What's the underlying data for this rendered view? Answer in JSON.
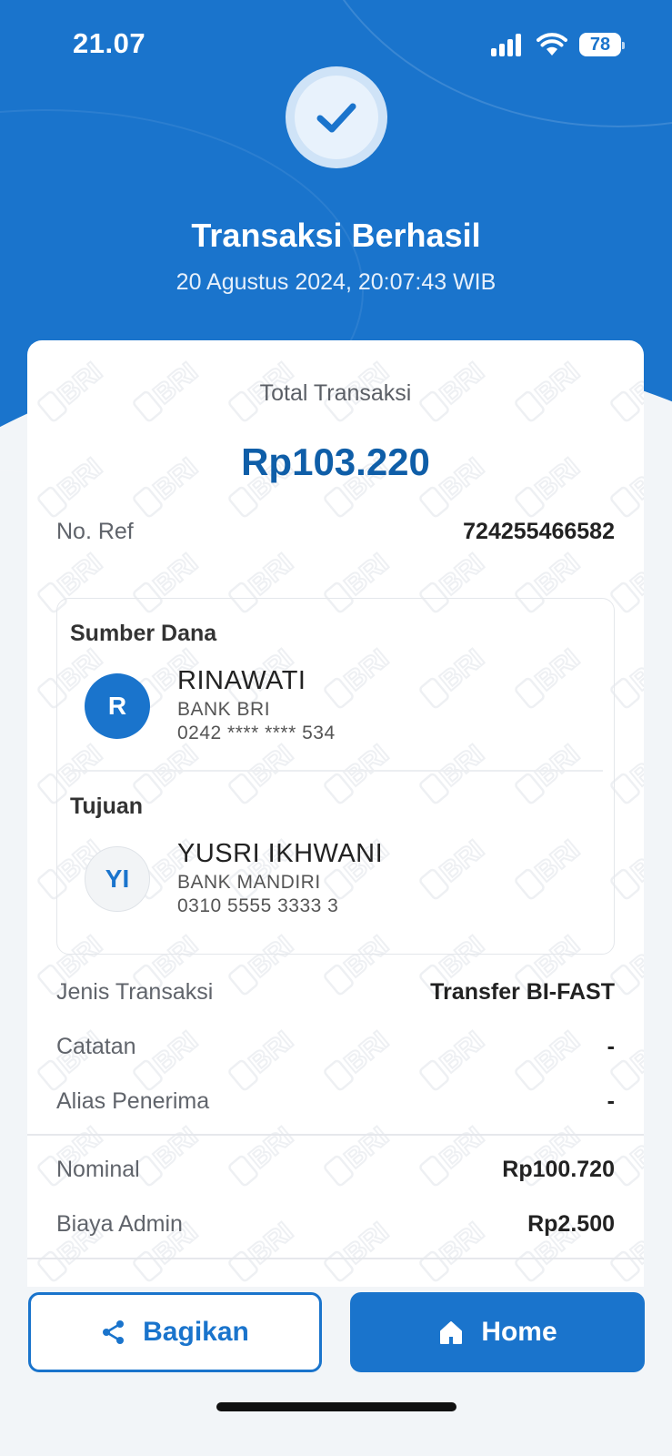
{
  "status_bar": {
    "time": "21.07",
    "battery": "78"
  },
  "header": {
    "title": "Transaksi Berhasil",
    "datetime": "20 Agustus 2024, 20:07:43 WIB"
  },
  "summary": {
    "total_label": "Total Transaksi",
    "total_amount": "Rp103.220",
    "ref_label": "No. Ref",
    "ref_value": "724255466582"
  },
  "source": {
    "heading": "Sumber Dana",
    "initials": "R",
    "name": "RINAWATI",
    "bank": "BANK BRI",
    "account": "0242 **** **** 534"
  },
  "destination": {
    "heading": "Tujuan",
    "initials": "YI",
    "name": "YUSRI IKHWANI",
    "bank": "BANK MANDIRI",
    "account": "0310 5555 3333 3"
  },
  "details": [
    {
      "label": "Jenis Transaksi",
      "value": "Transfer BI-FAST"
    },
    {
      "label": "Catatan",
      "value": "-"
    },
    {
      "label": "Alias Penerima",
      "value": "-"
    }
  ],
  "costs": [
    {
      "label": "Nominal",
      "value": "Rp100.720"
    },
    {
      "label": "Biaya Admin",
      "value": "Rp2.500"
    }
  ],
  "watermark_text": "BRI",
  "actions": {
    "share_label": "Bagikan",
    "home_label": "Home"
  },
  "colors": {
    "brand_blue": "#1a74cc",
    "amount_blue": "#0f5ea8"
  }
}
